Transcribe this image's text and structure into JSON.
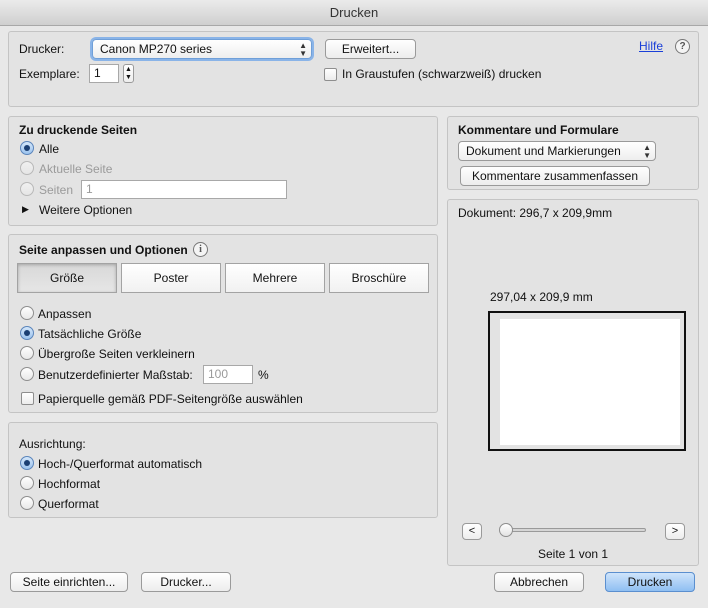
{
  "window": {
    "title": "Drucken"
  },
  "printer": {
    "label": "Drucker:",
    "selected": "Canon MP270 series",
    "advanced_button": "Erweitert...",
    "help_link": "Hilfe",
    "help_icon": "?",
    "copies_label": "Exemplare:",
    "copies_value": "1",
    "grayscale_label": "In Graustufen (schwarzweiß) drucken",
    "grayscale_checked": false
  },
  "pages": {
    "heading": "Zu druckende Seiten",
    "option_all": "Alle",
    "option_current": "Aktuelle Seite",
    "option_range": "Seiten",
    "range_value": "1",
    "more_options": "Weitere Optionen",
    "selected": "all"
  },
  "fit": {
    "heading": "Seite anpassen und Optionen",
    "info_icon": "i",
    "tabs": [
      {
        "label": "Größe",
        "active": true
      },
      {
        "label": "Poster",
        "active": false
      },
      {
        "label": "Mehrere",
        "active": false
      },
      {
        "label": "Broschüre",
        "active": false
      }
    ],
    "option_fit": "Anpassen",
    "option_actual": "Tatsächliche Größe",
    "option_shrink": "Übergroße Seiten verkleinern",
    "option_custom": "Benutzerdefinierter Maßstab:",
    "custom_value": "100",
    "custom_unit": "%",
    "paper_source": "Papierquelle gemäß PDF-Seitengröße auswählen",
    "selected": "actual"
  },
  "orientation": {
    "heading": "Ausrichtung:",
    "option_auto": "Hoch-/Querformat automatisch",
    "option_portrait": "Hochformat",
    "option_landscape": "Querformat",
    "selected": "auto"
  },
  "comments": {
    "heading": "Kommentare und Formulare",
    "selected": "Dokument und Markierungen",
    "summarize_button": "Kommentare zusammenfassen"
  },
  "preview": {
    "document_size": "Dokument: 296,7 x 209,9mm",
    "page_size": "297,04 x 209,9 mm",
    "prev_icon": "<",
    "next_icon": ">",
    "page_indicator": "Seite 1 von 1"
  },
  "footer": {
    "page_setup": "Seite einrichten...",
    "printer": "Drucker...",
    "cancel": "Abbrechen",
    "print": "Drucken"
  },
  "colors": {
    "accent": "#8fbff2",
    "link": "#1a3fd8",
    "background": "#e8e8e8"
  }
}
